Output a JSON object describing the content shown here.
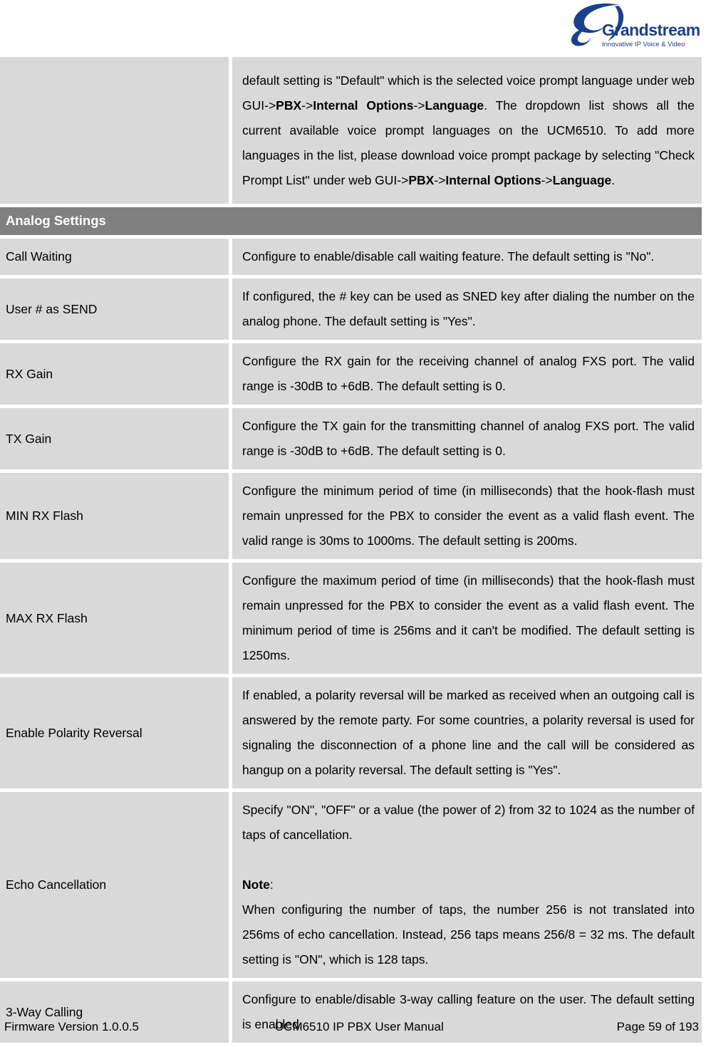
{
  "header": {
    "logo_name": "Grandstream",
    "logo_tagline": "Innovative IP Voice & Video"
  },
  "table": {
    "continued_row": {
      "label": "",
      "paragraphs": [
        {
          "runs": [
            {
              "t": "default setting is \"Default\" which is the selected voice prompt language under web GUI->",
              "b": false
            },
            {
              "t": "PBX",
              "b": true
            },
            {
              "t": "->",
              "b": false
            },
            {
              "t": "Internal Options",
              "b": true
            },
            {
              "t": "->",
              "b": false
            },
            {
              "t": "Language",
              "b": true
            },
            {
              "t": ". The dropdown list shows all the current available voice prompt languages on the UCM6510. To add more languages in the list, please download voice prompt package by selecting \"Check Prompt List\" under web GUI->",
              "b": false
            },
            {
              "t": "PBX",
              "b": true
            },
            {
              "t": "->",
              "b": false
            },
            {
              "t": "Internal Options",
              "b": true
            },
            {
              "t": "->",
              "b": false
            },
            {
              "t": "Language",
              "b": true
            },
            {
              "t": ".",
              "b": false
            }
          ]
        }
      ]
    },
    "section_header": "Analog Settings",
    "rows": [
      {
        "label": "Call Waiting",
        "paragraphs": [
          {
            "runs": [
              {
                "t": "Configure to enable/disable call waiting feature. The default setting is \"No\".",
                "b": false
              }
            ]
          }
        ]
      },
      {
        "label": "User # as SEND",
        "paragraphs": [
          {
            "runs": [
              {
                "t": "If configured, the # key can be used as SNED key after dialing the number on the analog phone. The default setting is \"Yes\".",
                "b": false
              }
            ]
          }
        ]
      },
      {
        "label": "RX Gain",
        "paragraphs": [
          {
            "runs": [
              {
                "t": "Configure the RX gain for the receiving channel of analog FXS port. The valid range is -30dB to +6dB. The default setting is 0.",
                "b": false
              }
            ]
          }
        ]
      },
      {
        "label": "TX Gain",
        "paragraphs": [
          {
            "runs": [
              {
                "t": "Configure the TX gain for the transmitting channel of analog FXS port. The valid range is -30dB to +6dB. The default setting is 0.",
                "b": false
              }
            ]
          }
        ]
      },
      {
        "label": "MIN RX Flash",
        "paragraphs": [
          {
            "runs": [
              {
                "t": "Configure the minimum period of time (in milliseconds) that the hook-flash must remain unpressed for the PBX to consider the event as a valid flash event. The valid range is 30ms to 1000ms. The default setting is 200ms.",
                "b": false
              }
            ]
          }
        ]
      },
      {
        "label": "MAX RX Flash",
        "paragraphs": [
          {
            "runs": [
              {
                "t": "Configure the maximum period of time (in milliseconds) that the hook-flash must remain unpressed for the PBX to consider the event as a valid flash event. The minimum period of time is 256ms and it can't be modified. The default setting is 1250ms.",
                "b": false
              }
            ]
          }
        ]
      },
      {
        "label": "Enable Polarity Reversal",
        "paragraphs": [
          {
            "runs": [
              {
                "t": "If enabled, a polarity reversal will be marked as received when an outgoing call is answered by the remote party. For some countries, a polarity reversal is used for signaling the disconnection of a phone line and the call will be considered as hangup on a polarity reversal. The default setting is \"Yes\".",
                "b": false
              }
            ]
          }
        ]
      },
      {
        "label": "Echo Cancellation",
        "paragraphs": [
          {
            "runs": [
              {
                "t": "Specify \"ON\", \"OFF\" or a value (the power of 2) from 32 to 1024 as the number of taps of cancellation.",
                "b": false
              }
            ]
          },
          {
            "blank": true,
            "runs": []
          },
          {
            "runs": [
              {
                "t": "Note",
                "b": true
              },
              {
                "t": ":",
                "b": false
              }
            ],
            "nojust": true
          },
          {
            "runs": [
              {
                "t": "When configuring the number of taps, the number 256 is not translated into 256ms of echo cancellation. Instead, 256 taps means 256/8 = 32 ms. The default setting is \"ON\", which is 128 taps.",
                "b": false
              }
            ]
          }
        ]
      },
      {
        "label": "3-Way Calling",
        "paragraphs": [
          {
            "runs": [
              {
                "t": "Configure to enable/disable 3-way calling feature on the user. The default setting is enabled.",
                "b": false
              }
            ]
          }
        ]
      }
    ]
  },
  "footer": {
    "firmware": "Firmware Version 1.0.0.5",
    "manual": "UCM6510 IP PBX User Manual",
    "page": "Page 59 of 193"
  },
  "colors": {
    "cell_bg": "#d9d9d9",
    "section_bg": "#808080",
    "logo_blue": "#1b3f8b",
    "page_bg": "#ffffff"
  }
}
